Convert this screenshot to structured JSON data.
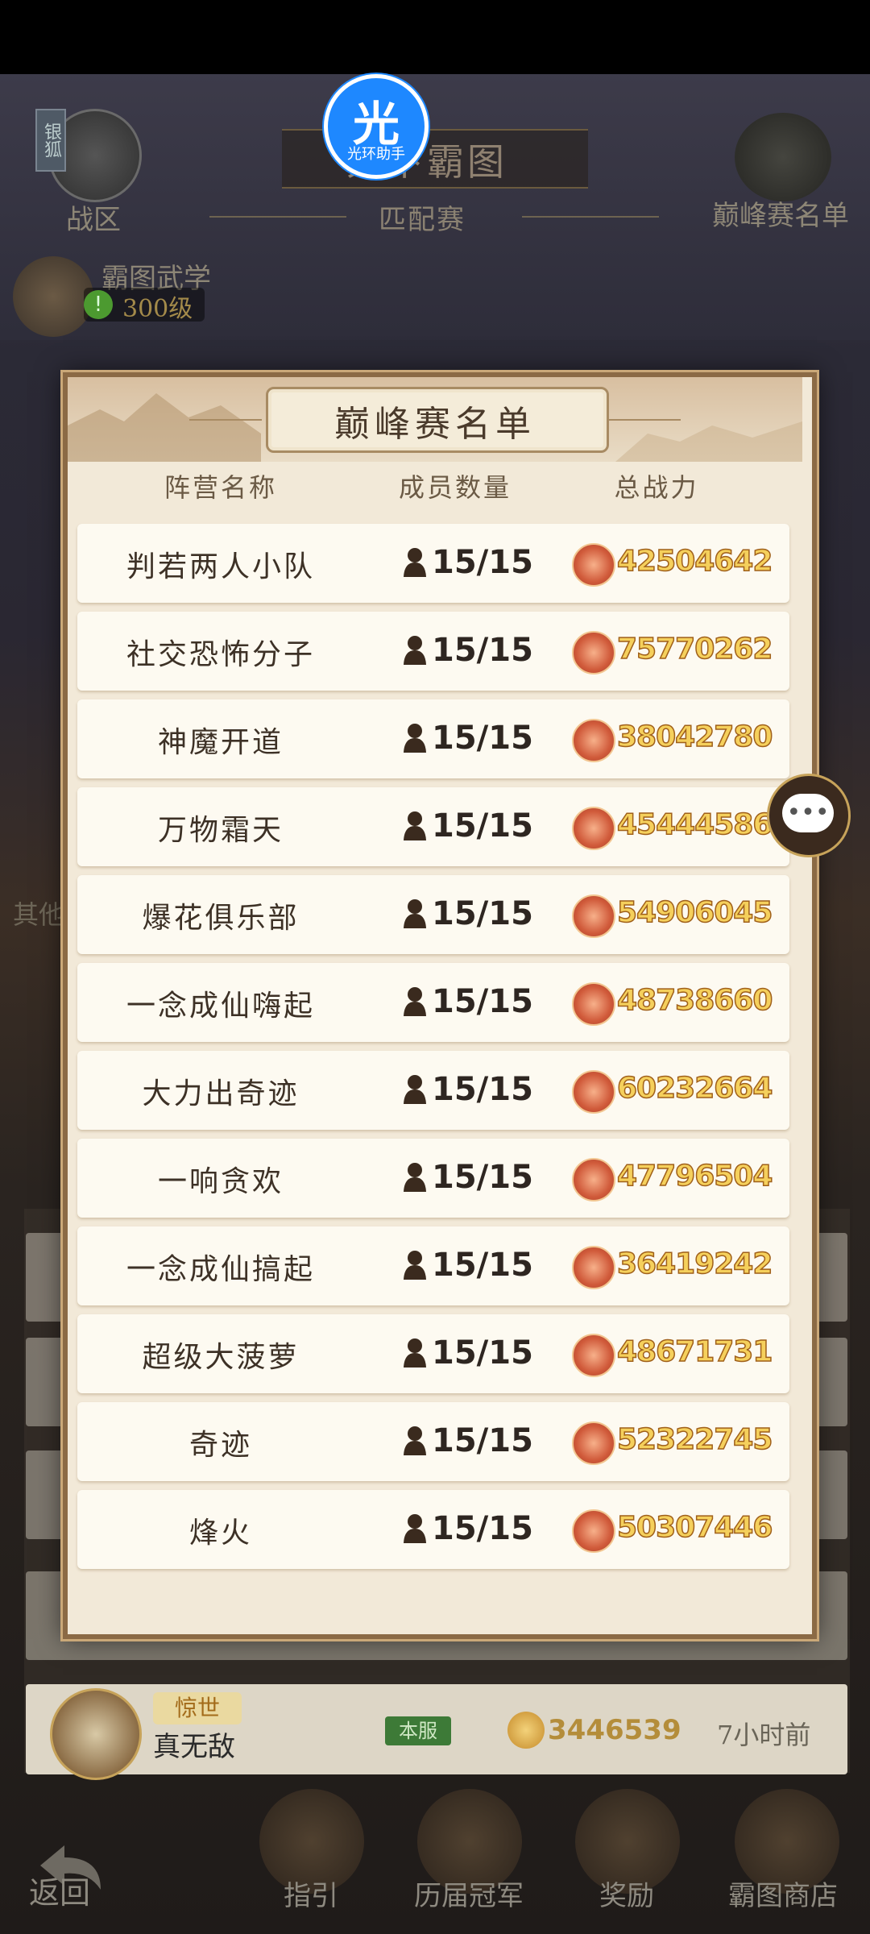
{
  "background": {
    "top_title": "天下霸图",
    "top_subtitle": "匹配赛",
    "zone_tag": "银狐",
    "zone_label": "战区",
    "peak_label": "巅峰赛名单",
    "helper_badge_glyph": "光",
    "helper_badge_caption": "光环助手",
    "wuxue_label": "霸图武学",
    "wuxue_level": "300级",
    "side_label": "其他",
    "list_player": {
      "title_tag": "惊世",
      "name": "真无敌",
      "server": "本服",
      "power": "3446539",
      "time": "7小时前"
    }
  },
  "bottom_nav": {
    "back": "返回",
    "guide": "指引",
    "champions": "历届冠军",
    "rewards": "奖励",
    "shop": "霸图商店"
  },
  "modal": {
    "title": "巅峰赛名单",
    "columns": [
      "阵营名称",
      "成员数量",
      "总战力"
    ],
    "rows": [
      {
        "name": "判若两人小队",
        "members": "15/15",
        "power": "42504642"
      },
      {
        "name": "社交恐怖分子",
        "members": "15/15",
        "power": "75770262"
      },
      {
        "name": "神魔开道",
        "members": "15/15",
        "power": "38042780"
      },
      {
        "name": "万物霜天",
        "members": "15/15",
        "power": "45444586"
      },
      {
        "name": "爆花俱乐部",
        "members": "15/15",
        "power": "54906045"
      },
      {
        "name": "一念成仙嗨起",
        "members": "15/15",
        "power": "48738660"
      },
      {
        "name": "大力出奇迹",
        "members": "15/15",
        "power": "60232664"
      },
      {
        "name": "一响贪欢",
        "members": "15/15",
        "power": "47796504"
      },
      {
        "name": "一念成仙搞起",
        "members": "15/15",
        "power": "36419242"
      },
      {
        "name": "超级大菠萝",
        "members": "15/15",
        "power": "48671731"
      },
      {
        "name": "奇迹",
        "members": "15/15",
        "power": "52322745"
      },
      {
        "name": "烽火",
        "members": "15/15",
        "power": "50307446"
      }
    ]
  },
  "colors": {
    "modal_bg": "#f2e9d8",
    "row_bg": "#fdfaf1",
    "power_text": "#f5d05c",
    "frame": "#8b6a45"
  }
}
